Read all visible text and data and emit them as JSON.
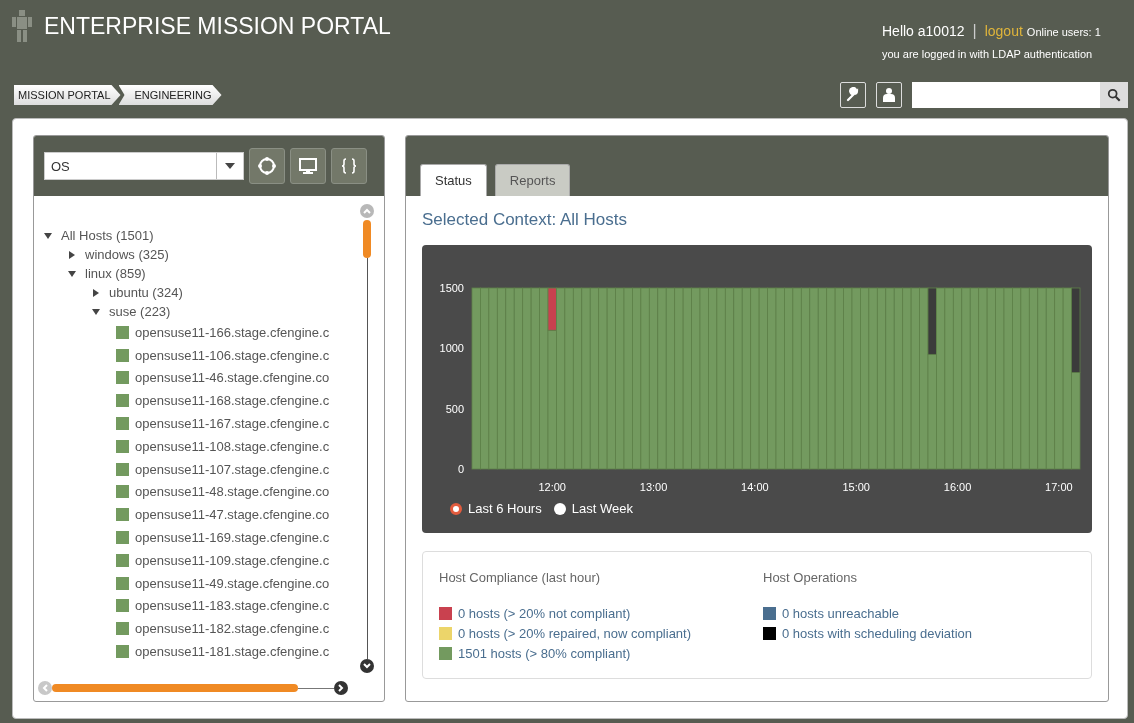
{
  "header": {
    "title": "ENTERPRISE MISSION PORTAL",
    "greeting": "Hello a10012",
    "separator": "|",
    "logout": "logout",
    "online_users": "Online users: 1",
    "auth_note": "you are logged in with LDAP authentication"
  },
  "breadcrumb": [
    "MISSION PORTAL",
    "ENGINEERING"
  ],
  "left_panel": {
    "filter": {
      "value": "OS"
    },
    "tree": [
      {
        "label": "All Hosts (1501)",
        "expanded": true,
        "children": [
          {
            "label": "windows (325)",
            "expanded": false
          },
          {
            "label": "linux (859)",
            "expanded": true,
            "children": [
              {
                "label": "ubuntu (324)",
                "expanded": false
              },
              {
                "label": "suse (223)",
                "expanded": true,
                "children": [
                  {
                    "label": "opensuse11-166.stage.cfengine.c",
                    "color": "#739a5f"
                  },
                  {
                    "label": "opensuse11-106.stage.cfengine.c",
                    "color": "#739a5f"
                  },
                  {
                    "label": "opensuse11-46.stage.cfengine.co",
                    "color": "#739a5f"
                  },
                  {
                    "label": "opensuse11-168.stage.cfengine.c",
                    "color": "#739a5f"
                  },
                  {
                    "label": "opensuse11-167.stage.cfengine.c",
                    "color": "#739a5f"
                  },
                  {
                    "label": "opensuse11-108.stage.cfengine.c",
                    "color": "#739a5f"
                  },
                  {
                    "label": "opensuse11-107.stage.cfengine.c",
                    "color": "#739a5f"
                  },
                  {
                    "label": "opensuse11-48.stage.cfengine.co",
                    "color": "#739a5f"
                  },
                  {
                    "label": "opensuse11-47.stage.cfengine.co",
                    "color": "#739a5f"
                  },
                  {
                    "label": "opensuse11-169.stage.cfengine.c",
                    "color": "#739a5f"
                  },
                  {
                    "label": "opensuse11-109.stage.cfengine.c",
                    "color": "#739a5f"
                  },
                  {
                    "label": "opensuse11-49.stage.cfengine.co",
                    "color": "#739a5f"
                  },
                  {
                    "label": "opensuse11-183.stage.cfengine.c",
                    "color": "#739a5f"
                  },
                  {
                    "label": "opensuse11-182.stage.cfengine.c",
                    "color": "#739a5f"
                  },
                  {
                    "label": "opensuse11-181.stage.cfengine.c",
                    "color": "#739a5f"
                  }
                ]
              }
            ]
          }
        ]
      }
    ]
  },
  "tabs": [
    {
      "label": "Status",
      "selected": true
    },
    {
      "label": "Reports",
      "selected": false
    }
  ],
  "context_title": "Selected Context: All Hosts",
  "chart_data": {
    "type": "bar",
    "stacked": true,
    "x": [
      675,
      680,
      685,
      690,
      695,
      700,
      705,
      710,
      715,
      720,
      725,
      730,
      735,
      740,
      745,
      750,
      755,
      760,
      765,
      770,
      775,
      780,
      785,
      790,
      795,
      800,
      805,
      810,
      815,
      820,
      825,
      830,
      835,
      840,
      845,
      850,
      855,
      860,
      865,
      870,
      875,
      880,
      885,
      890,
      895,
      900,
      905,
      910,
      915,
      920,
      925,
      930,
      935,
      940,
      945,
      950,
      955,
      960,
      965,
      970,
      975,
      980,
      985,
      990,
      995,
      1000,
      1005,
      1010,
      1015,
      1020,
      1025,
      1030
    ],
    "series": [
      {
        "color": "#739a5f",
        "values": [
          1500,
          1500,
          1500,
          1500,
          1500,
          1500,
          1500,
          1500,
          1500,
          1150,
          1500,
          1500,
          1500,
          1500,
          1500,
          1500,
          1500,
          1500,
          1500,
          1500,
          1500,
          1500,
          1500,
          1500,
          1500,
          1500,
          1500,
          1500,
          1500,
          1500,
          1500,
          1500,
          1500,
          1500,
          1500,
          1500,
          1500,
          1500,
          1500,
          1500,
          1500,
          1500,
          1500,
          1500,
          1500,
          1500,
          1500,
          1500,
          1500,
          1500,
          1500,
          1500,
          1500,
          1500,
          950,
          1500,
          1500,
          1500,
          1500,
          1500,
          1500,
          1500,
          1500,
          1500,
          1500,
          1500,
          1500,
          1500,
          1500,
          1500,
          1500,
          800
        ]
      },
      {
        "color": "#c9414f",
        "values": [
          0,
          0,
          0,
          0,
          0,
          0,
          0,
          0,
          0,
          350,
          0,
          0,
          0,
          0,
          0,
          0,
          0,
          0,
          0,
          0,
          0,
          0,
          0,
          0,
          0,
          0,
          0,
          0,
          0,
          0,
          0,
          0,
          0,
          0,
          0,
          0,
          0,
          0,
          0,
          0,
          0,
          0,
          0,
          0,
          0,
          0,
          0,
          0,
          0,
          0,
          0,
          0,
          0,
          0,
          0,
          0,
          0,
          0,
          0,
          0,
          0,
          0,
          0,
          0,
          0,
          0,
          0,
          0,
          0,
          0,
          0,
          0
        ]
      },
      {
        "color": "#3b3b3b",
        "values": [
          0,
          0,
          0,
          0,
          0,
          0,
          0,
          0,
          0,
          0,
          0,
          0,
          0,
          0,
          0,
          0,
          0,
          0,
          0,
          0,
          0,
          0,
          0,
          0,
          0,
          0,
          0,
          0,
          0,
          0,
          0,
          0,
          0,
          0,
          0,
          0,
          0,
          0,
          0,
          0,
          0,
          0,
          0,
          0,
          0,
          0,
          0,
          0,
          0,
          0,
          0,
          0,
          0,
          0,
          550,
          0,
          0,
          0,
          0,
          0,
          0,
          0,
          0,
          0,
          0,
          0,
          0,
          0,
          0,
          0,
          0,
          700
        ]
      }
    ],
    "xlim": [
      672.5,
      1032.5
    ],
    "ylim": [
      0,
      1500
    ],
    "yticks": [
      0,
      500,
      1000,
      1500
    ],
    "xticks": [
      {
        "value": 720,
        "label": "12:00"
      },
      {
        "value": 780,
        "label": "13:00"
      },
      {
        "value": 840,
        "label": "14:00"
      },
      {
        "value": 900,
        "label": "15:00"
      },
      {
        "value": 960,
        "label": "16:00"
      },
      {
        "value": 1020,
        "label": "17:00"
      }
    ]
  },
  "range_options": [
    {
      "label": "Last 6 Hours",
      "selected": true
    },
    {
      "label": "Last Week",
      "selected": false
    }
  ],
  "summary": [
    {
      "title": "Host Compliance (last hour)",
      "items": [
        {
          "label": "0 hosts (> 20% not compliant)",
          "color": "#c9414f"
        },
        {
          "label": "0 hosts (> 20% repaired, now compliant)",
          "color": "#ecd56a"
        },
        {
          "label": "1501 hosts (> 80% compliant)",
          "color": "#739a5f"
        }
      ]
    },
    {
      "title": "Host Operations",
      "items": [
        {
          "label": "0 hosts unreachable",
          "color": "#4a6e8f"
        },
        {
          "label": "0 hosts with scheduling deviation",
          "color": "#000000"
        }
      ]
    }
  ]
}
